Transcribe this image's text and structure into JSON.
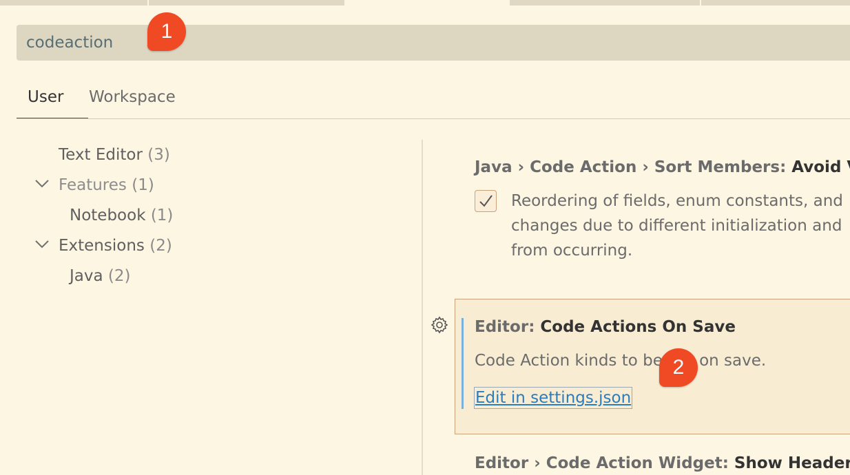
{
  "search": {
    "value": "codeaction",
    "placeholder": ""
  },
  "annotations": {
    "first": "1",
    "second": "2"
  },
  "tabs": [
    {
      "label": "User",
      "active": true
    },
    {
      "label": "Workspace",
      "active": false
    }
  ],
  "toc": [
    {
      "label": "Text Editor",
      "count": "(3)"
    },
    {
      "label": "Features",
      "count": "(1)",
      "expanded": true
    },
    {
      "label": "Notebook",
      "count": "(1)"
    },
    {
      "label": "Extensions",
      "count": "(2)",
      "expanded": true
    },
    {
      "label": "Java",
      "count": "(2)"
    }
  ],
  "settings": [
    {
      "category": "Java › Code Action › Sort Members: ",
      "name": "Avoid V",
      "checked": true,
      "description_lines": [
        "Reordering of fields, enum constants, and",
        "changes due to different initialization and",
        "from occurring."
      ]
    },
    {
      "category": "Editor: ",
      "name": "Code Actions On Save",
      "description": "Code Action kinds to be run on save.",
      "link": "Edit in settings.json"
    },
    {
      "category": "Editor › Code Action Widget: ",
      "name": "Show Headers"
    }
  ],
  "colors": {
    "background": "#fdf6e3",
    "accent": "#f04a24",
    "link": "#2a7bbf",
    "focus_border": "#78b1dc"
  }
}
